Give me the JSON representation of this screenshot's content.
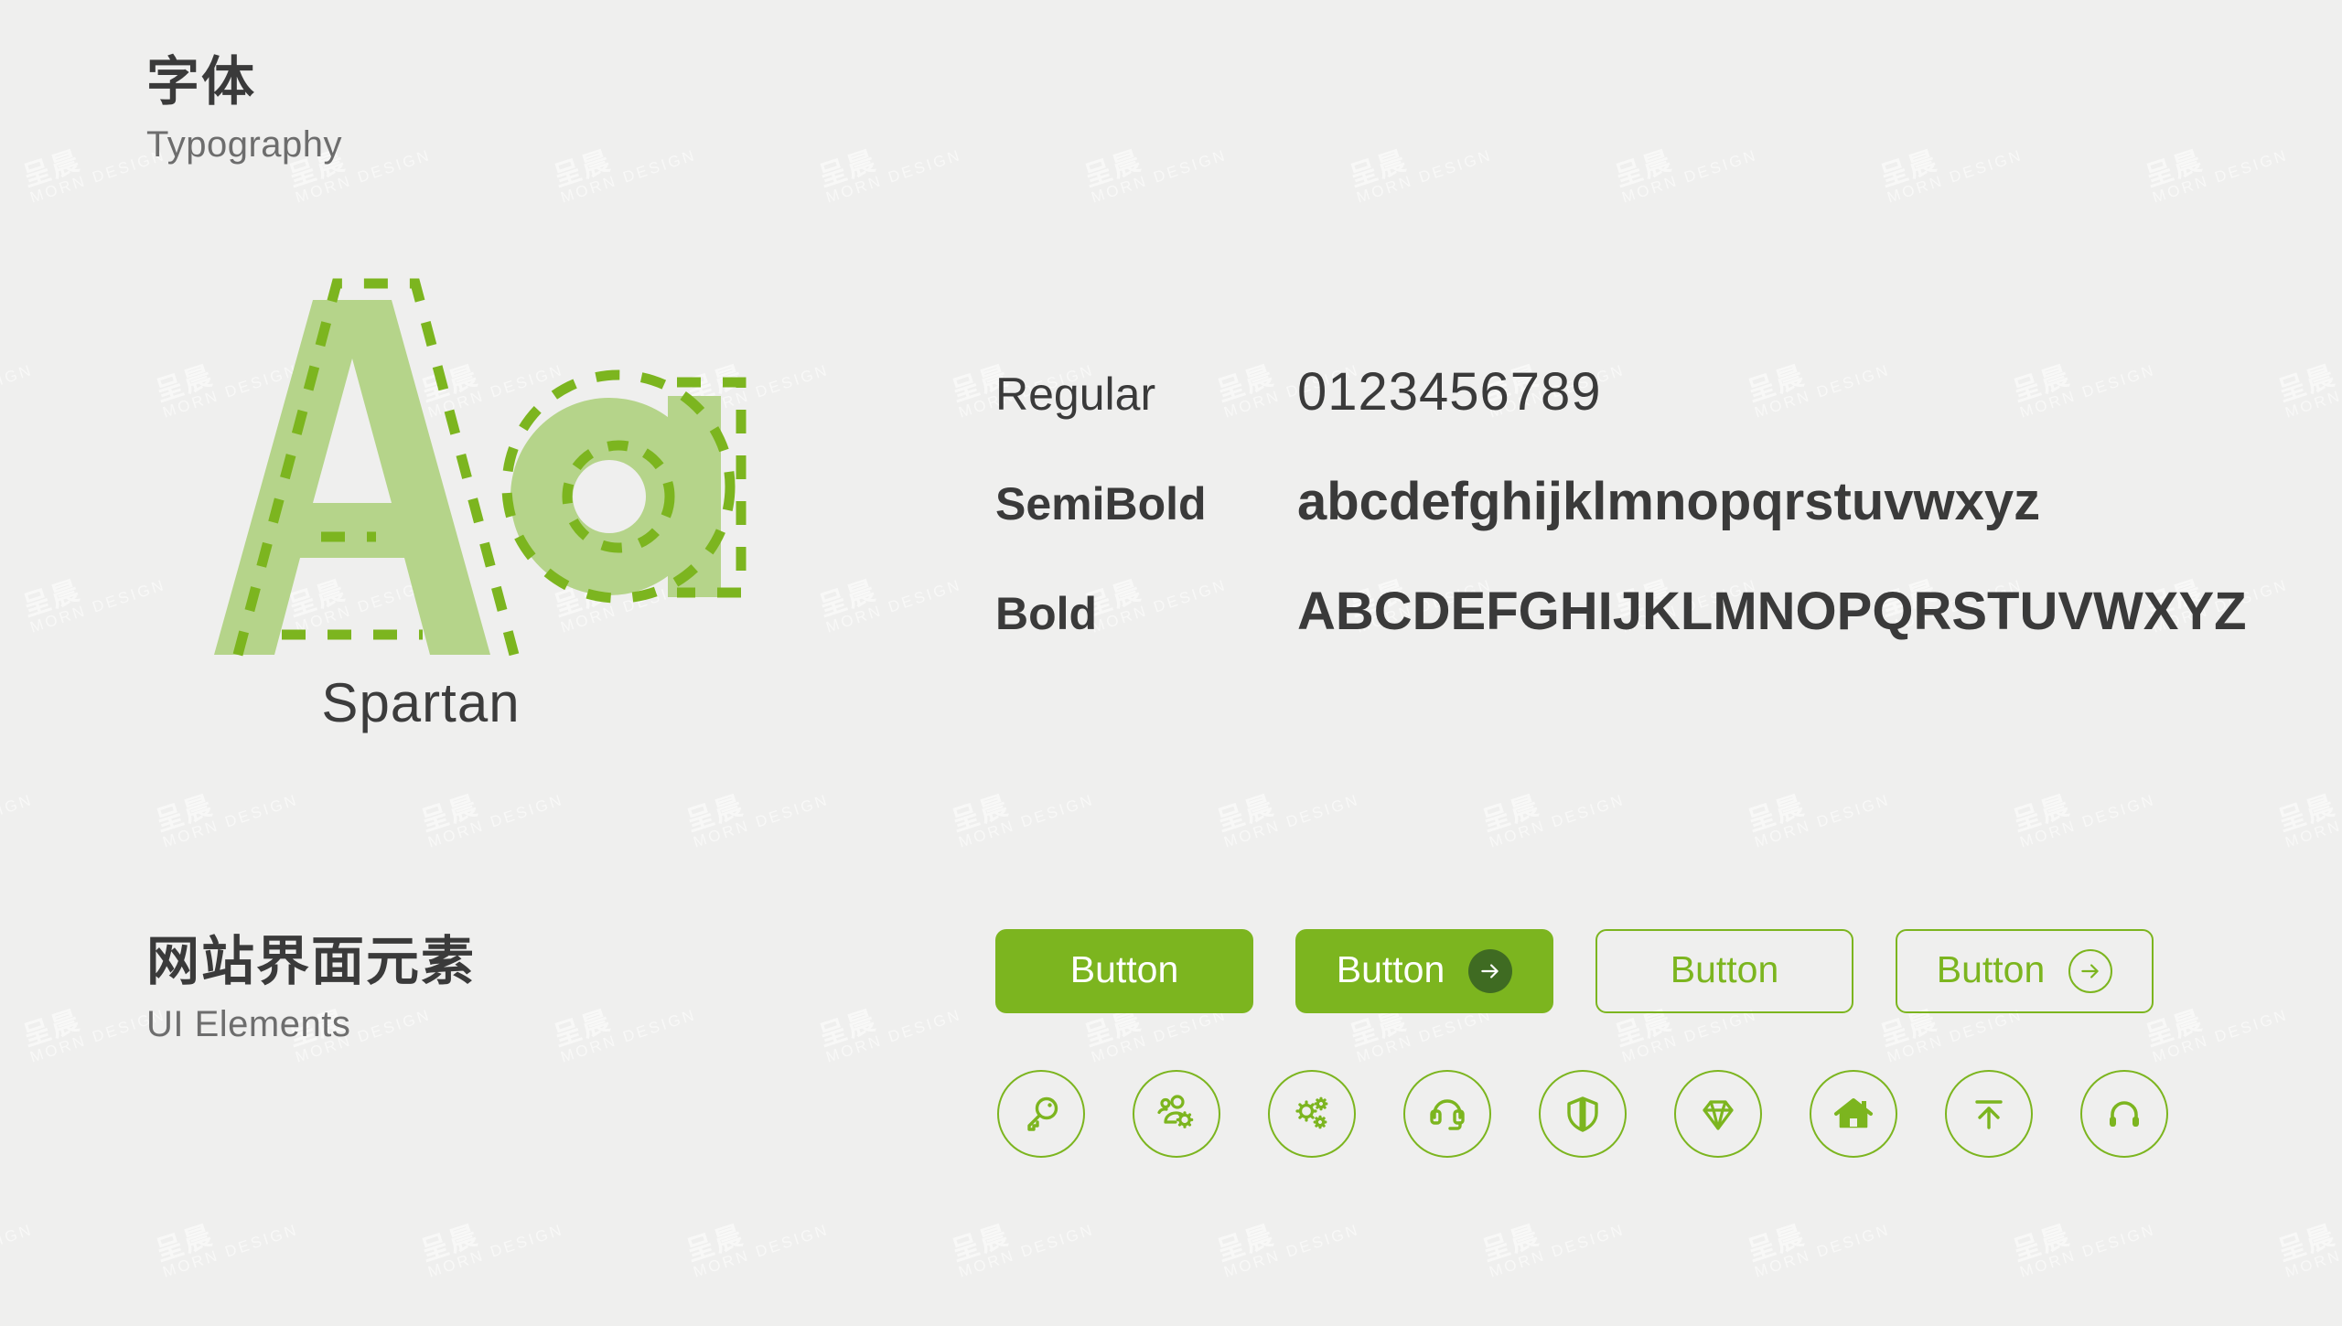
{
  "theme": {
    "background": "#efefee",
    "accent_green": "#7cb51f",
    "accent_green_dark": "#3f6b22",
    "letter_fill": "#b5d48a",
    "letter_outline": "#7cb51f",
    "text_dark": "#3a3a3a",
    "text_muted": "#6d6d6d"
  },
  "watermark": {
    "cn": "呈晨",
    "en": "MORN DESIGN"
  },
  "typography_section": {
    "title_cn": "字体",
    "title_en": "Typography",
    "specimen_glyphs": "Aa",
    "font_name": "Spartan",
    "weights": [
      {
        "label": "Regular",
        "sample": "0123456789"
      },
      {
        "label": "SemiBold",
        "sample": "abcdefghijklmnopqrstuvwxyz"
      },
      {
        "label": "Bold",
        "sample": "ABCDEFGHIJKLMNOPQRSTUVWXYZ"
      }
    ]
  },
  "ui_section": {
    "title_cn": "网站界面元素",
    "title_en": "UI Elements",
    "buttons": [
      {
        "label": "Button",
        "style": "solid",
        "has_arrow": false
      },
      {
        "label": "Button",
        "style": "solid",
        "has_arrow": true
      },
      {
        "label": "Button",
        "style": "outline",
        "has_arrow": false
      },
      {
        "label": "Button",
        "style": "outline",
        "has_arrow": true
      }
    ],
    "icons": [
      {
        "name": "key-icon"
      },
      {
        "name": "user-settings-icon"
      },
      {
        "name": "gears-settings-icon"
      },
      {
        "name": "headset-support-icon"
      },
      {
        "name": "shield-icon"
      },
      {
        "name": "diamond-icon"
      },
      {
        "name": "home-icon"
      },
      {
        "name": "upload-icon"
      },
      {
        "name": "headphones-icon"
      }
    ]
  }
}
